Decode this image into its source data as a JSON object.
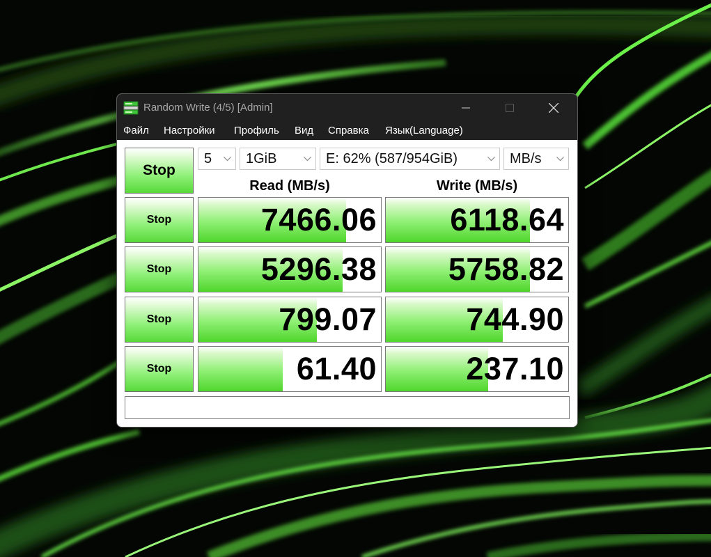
{
  "window": {
    "title": "Random Write (4/5) [Admin]",
    "icon": "disk-drive-icon",
    "controls": [
      "minimize-icon",
      "maximize-icon",
      "close-icon"
    ]
  },
  "menu": {
    "items": [
      {
        "label": "Файл"
      },
      {
        "label": "Настройки"
      },
      {
        "label": "Профиль"
      },
      {
        "label": "Вид"
      },
      {
        "label": "Справка"
      },
      {
        "label": "Язык(Language)"
      }
    ]
  },
  "controls": {
    "main_button": "Stop",
    "count": "5",
    "size": "1GiB",
    "drive": "E: 62% (587/954GiB)",
    "unit": "MB/s"
  },
  "headers": {
    "read": "Read (MB/s)",
    "write": "Write (MB/s)"
  },
  "rows": [
    {
      "button": "Stop",
      "read": "7466.06",
      "write": "6118.64",
      "read_fill": 0.81,
      "write_fill": 0.79
    },
    {
      "button": "Stop",
      "read": "5296.38",
      "write": "5758.82",
      "read_fill": 0.79,
      "write_fill": 0.79
    },
    {
      "button": "Stop",
      "read": "799.07",
      "write": "744.90",
      "read_fill": 0.65,
      "write_fill": 0.64
    },
    {
      "button": "Stop",
      "read": "61.40",
      "write": "237.10",
      "read_fill": 0.46,
      "write_fill": 0.56
    }
  ],
  "comment": "",
  "colors": {
    "bar_green": "#58d93a",
    "titlebar": "#202020",
    "wallpaper_green": "#6cf04a"
  }
}
